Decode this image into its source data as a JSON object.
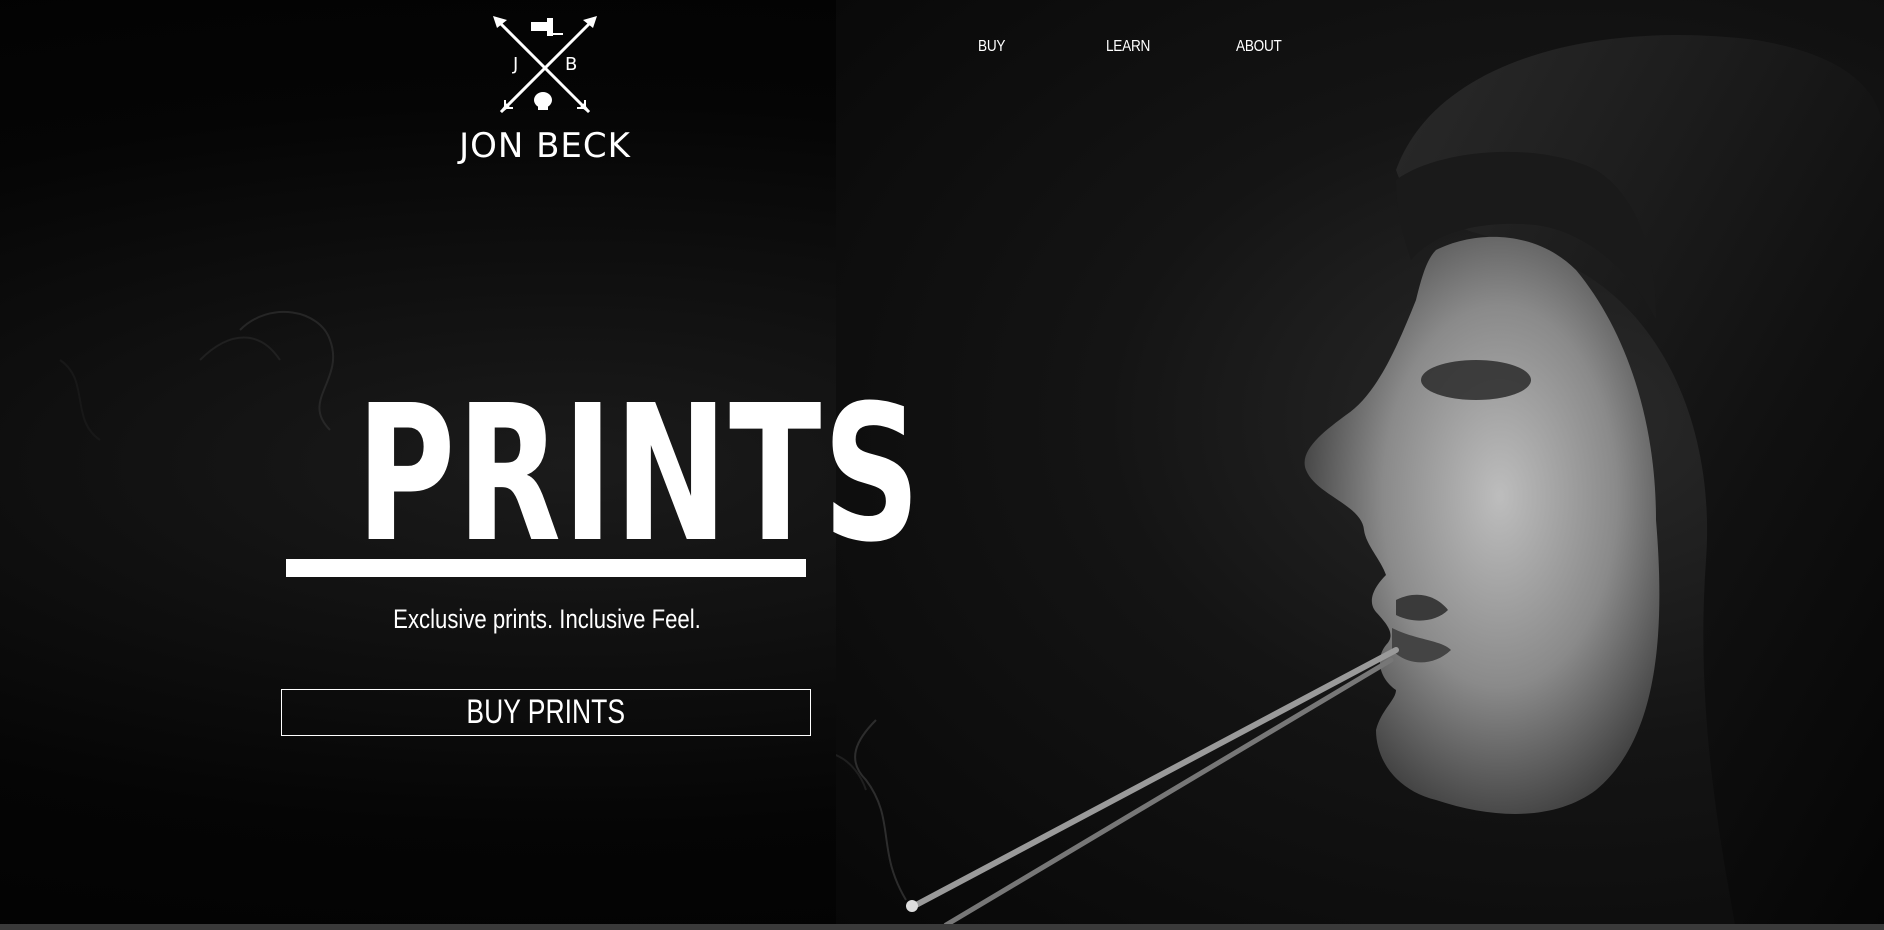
{
  "brand": {
    "initial_left": "J",
    "initial_right": "B",
    "name": "JON BECK",
    "icon": "crossed-arrows-logo"
  },
  "nav": {
    "items": [
      {
        "label": "BUY"
      },
      {
        "label": "LEARN"
      },
      {
        "label": "ABOUT"
      }
    ]
  },
  "hero": {
    "title": "PRINTS",
    "tagline": "Exclusive prints. Inclusive Feel.",
    "button_label": "BUY PRINTS"
  },
  "colors": {
    "background": "#000000",
    "text": "#ffffff"
  }
}
